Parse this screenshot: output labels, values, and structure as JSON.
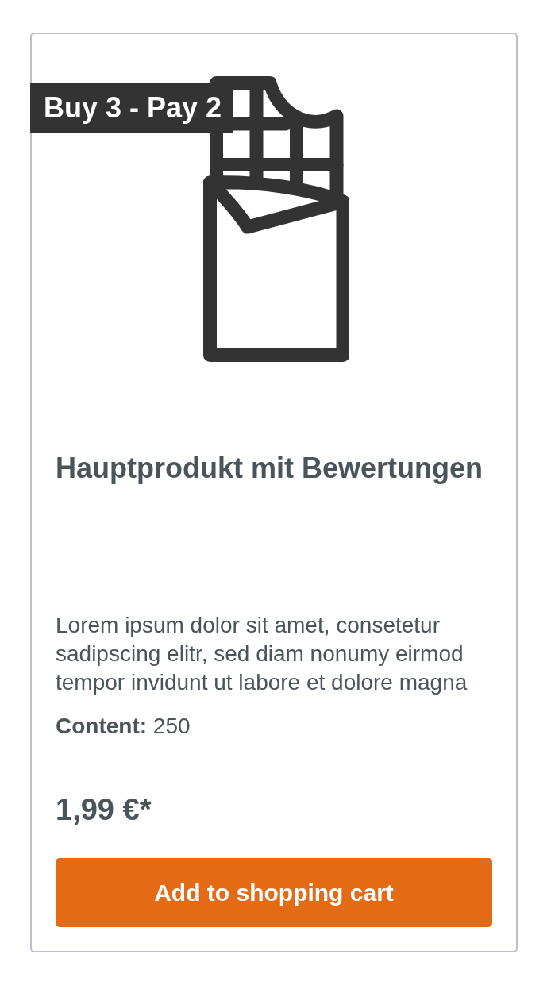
{
  "badge": {
    "text": "Buy 3 - Pay 2"
  },
  "product": {
    "title": "Hauptprodukt mit Bewertungen",
    "description": "Lorem ipsum dolor sit amet, consetetur sadipscing elitr, sed diam nonumy eirmod tempor invidunt ut labore et dolore magna",
    "content": "**Content:** 250",
    "price": "1,99 €*"
  },
  "button": {
    "label": "Add to shopping cart"
  }
}
